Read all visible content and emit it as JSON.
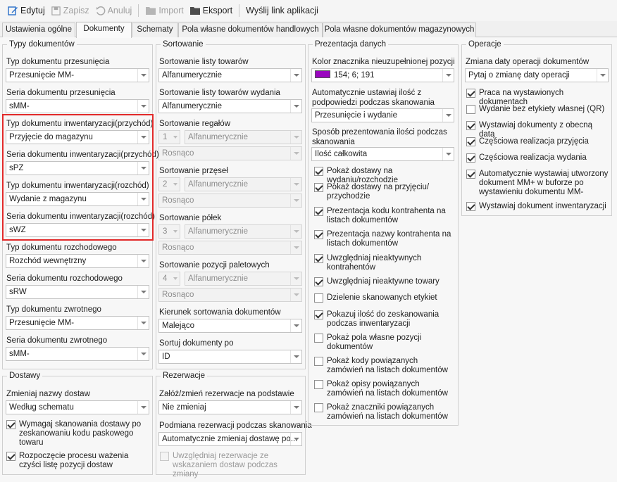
{
  "toolbar": {
    "edit": "Edytuj",
    "save": "Zapisz",
    "cancel": "Anuluj",
    "import": "Import",
    "export": "Eksport",
    "share": "Wyślij link aplikacji"
  },
  "tabs": [
    "Ustawienia ogólne",
    "Dokumenty",
    "Schematy",
    "Pola własne dokumentów handlowych",
    "Pola własne dokumentów magazynowych"
  ],
  "typy": {
    "legend": "Typy dokumentów",
    "items": [
      {
        "label": "Typ dokumentu przesunięcia",
        "value": "Przesunięcie MM-"
      },
      {
        "label": "Seria dokumentu przesunięcia",
        "value": "sMM-"
      },
      {
        "label": "Typ dokumentu inwentaryzacji(przychód)",
        "value": "Przyjęcie do magazynu"
      },
      {
        "label": "Seria dokumentu inwentaryzacji(przychód)",
        "value": "sPZ"
      },
      {
        "label": "Typ dokumentu inwentaryzacji(rozchód)",
        "value": "Wydanie z magazynu"
      },
      {
        "label": "Seria dokumentu inwentaryzacji(rozchód)",
        "value": "sWZ"
      },
      {
        "label": "Typ dokumentu rozchodowego",
        "value": "Rozchód wewnętrzny"
      },
      {
        "label": "Seria dokumentu rozchodowego",
        "value": "sRW"
      },
      {
        "label": "Typ dokumentu zwrotnego",
        "value": "Przesunięcie MM-"
      },
      {
        "label": "Seria dokumentu zwrotnego",
        "value": "sMM-"
      }
    ]
  },
  "dostawy": {
    "legend": "Dostawy",
    "label": "Zmieniaj nazwy dostaw",
    "value": "Według schematu",
    "check1": "Wymagaj skanowania dostawy po zeskanowaniu kodu paskowego towaru",
    "check2": "Rozpoczęcie procesu ważenia czyści listę pozycji dostaw"
  },
  "sortowanie": {
    "legend": "Sortowanie",
    "lista_label": "Sortowanie listy towarów",
    "lista_value": "Alfanumerycznie",
    "wydania_label": "Sortowanie listy towarów wydania",
    "wydania_value": "Alfanumerycznie",
    "regalow_label": "Sortowanie regałów",
    "przesel_label": "Sortowanie przęseł",
    "polek_label": "Sortowanie półek",
    "paletowych_label": "Sortowanie pozycji paletowych",
    "alpha": "Alfanumerycznie",
    "order": "Rosnąco",
    "n1": "1",
    "n2": "2",
    "n3": "3",
    "n4": "4",
    "kierunek_label": "Kierunek sortowania dokumentów",
    "kierunek_value": "Malejąco",
    "sortuj_label": "Sortuj dokumenty po",
    "sortuj_value": "ID"
  },
  "rezerwacje": {
    "legend": "Rezerwacje",
    "zaloz_label": "Załóż/zmień rezerwacje na podstawie",
    "zaloz_value": "Nie zmieniaj",
    "podmiana_label": "Podmiana rezerwacji podczas skanowania",
    "podmiana_value": "Automatycznie zmieniaj dostawę po...",
    "check": "Uwzględniaj rezerwacje ze wskazaniem dostaw podczas zmiany"
  },
  "prezentacja": {
    "legend": "Prezentacja danych",
    "kolor_label": "Kolor znacznika nieuzupełnionej pozycji",
    "kolor_value": "154; 6; 191",
    "kolor_hex": "#9a06bf",
    "auto_label": "Automatycznie ustawiaj ilość z podpowiedzi podczas skanowania",
    "auto_value": "Przesunięcie i wydanie",
    "sposob_label": "Sposób prezentowania ilości podczas skanowania",
    "sposob_value": "Ilość całkowita",
    "checks": [
      {
        "text": "Pokaż dostawy na wydaniu/rozchodzie",
        "on": true
      },
      {
        "text": "Pokaż dostawy na przyjęciu/ przychodzie",
        "on": true
      },
      {
        "text": "Prezentacja kodu kontrahenta na listach dokumentów",
        "on": true
      },
      {
        "text": "Prezentacja nazwy kontrahenta na listach dokumentów",
        "on": true
      },
      {
        "text": "Uwzględniaj nieaktywnych kontrahentów",
        "on": true
      },
      {
        "text": "Uwzględniaj nieaktywne towary",
        "on": true
      },
      {
        "text": "Dzielenie skanowanych etykiet",
        "on": false
      },
      {
        "text": "Pokazuj ilość do zeskanowania podczas inwentaryzacji",
        "on": true
      },
      {
        "text": "Pokaż pola własne pozycji dokumentów",
        "on": false
      },
      {
        "text": "Pokaż kody powiązanych zamówień na listach dokumentów",
        "on": false
      },
      {
        "text": "Pokaż opisy powiązanych zamówień na listach dokumentów",
        "on": false
      },
      {
        "text": "Pokaż znaczniki powiązanych zamówień na listach dokumentów",
        "on": false
      }
    ]
  },
  "operacje": {
    "legend": "Operacje",
    "label": "Zmiana daty operacji dokumentów",
    "value": "Pytaj o zmianę daty operacji",
    "checks": [
      {
        "text": "Praca na wystawionych dokumentach",
        "on": true
      },
      {
        "text": "Wydanie bez etykiety własnej (QR)",
        "on": false
      },
      {
        "text": "Wystawiaj dokumenty z obecną datą",
        "on": true
      },
      {
        "text": "Częściowa realizacja przyjęcia",
        "on": true
      },
      {
        "text": "Częściowa realizacja wydania",
        "on": true
      },
      {
        "text": "Automatycznie wystawiaj utworzony dokument MM+ w buforze po wystawieniu dokumentu MM-",
        "on": true
      },
      {
        "text": "Wystawiaj dokument inwentaryzacji",
        "on": true
      }
    ]
  }
}
